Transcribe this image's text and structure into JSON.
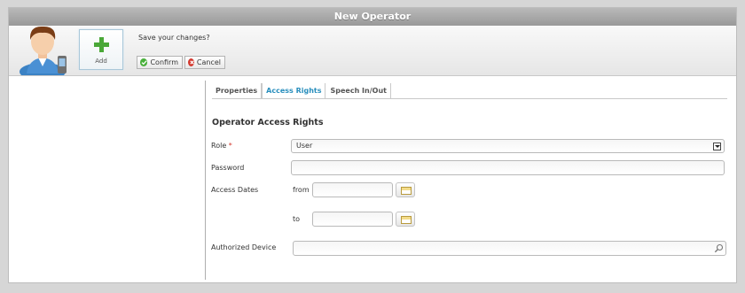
{
  "window": {
    "title": "New Operator"
  },
  "toolbar": {
    "add_label": "Add",
    "save_prompt": "Save your changes?",
    "confirm_label": "Confirm",
    "cancel_label": "Cancel"
  },
  "tabs": [
    {
      "label": "Properties",
      "active": false
    },
    {
      "label": "Access Rights",
      "active": true
    },
    {
      "label": "Speech In/Out",
      "active": false
    }
  ],
  "form": {
    "title": "Operator Access Rights",
    "role_label": "Role",
    "role_required_marker": "*",
    "role_value": "User",
    "password_label": "Password",
    "password_value": "",
    "access_dates_label": "Access Dates",
    "from_label": "from",
    "from_value": "",
    "to_label": "to",
    "to_value": "",
    "authorized_device_label": "Authorized Device",
    "authorized_device_value": ""
  },
  "icons": {
    "add": "plus-icon",
    "confirm": "check-circle-icon",
    "cancel": "x-circle-icon",
    "calendar": "calendar-icon",
    "search": "magnifier-icon",
    "dropdown": "chevron-down-icon"
  },
  "colors": {
    "accent_tab": "#2a8fbd",
    "confirm_green": "#49b03b",
    "cancel_red": "#d33a30",
    "titlebar": "#a8a8a8"
  }
}
